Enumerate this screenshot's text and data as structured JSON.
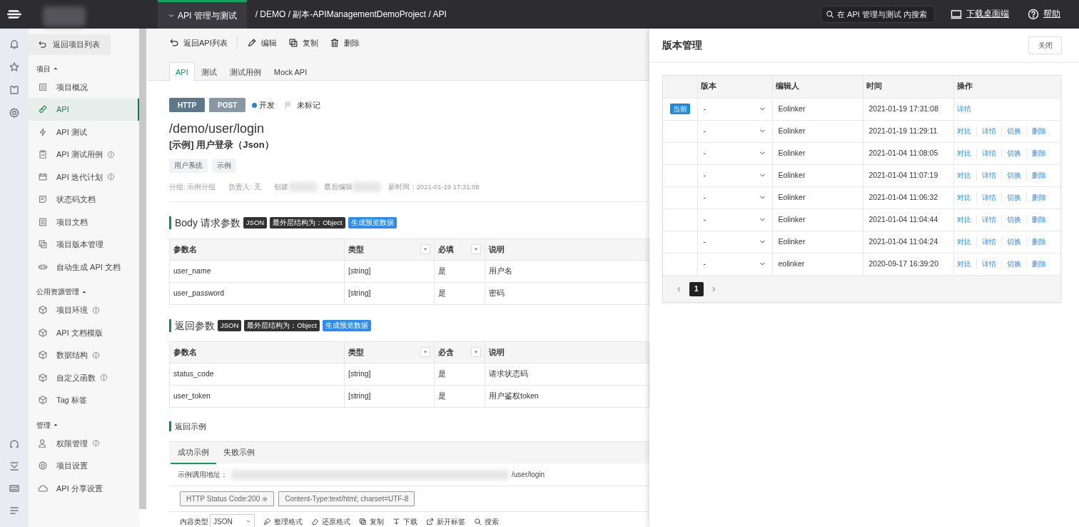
{
  "top_bar": {
    "module": "API 管理与测试",
    "breadcrumb": "/ DEMO / 副本-APIManagementDemoProject / API",
    "search": {
      "placeholder": "在 API 管理与测试 内搜索"
    },
    "links": [
      "下载桌面端",
      "帮助"
    ]
  },
  "sidebar": {
    "back": "返回项目列表",
    "sections": [
      {
        "title": "项目",
        "expanded": true,
        "items": [
          {
            "label": "项目概况",
            "selected": false,
            "info": false
          },
          {
            "label": "API",
            "selected": true,
            "info": false
          },
          {
            "label": "API 测试",
            "selected": false,
            "info": false
          },
          {
            "label": "API 测试用例",
            "selected": false,
            "info": true
          },
          {
            "label": "API 迭代计划",
            "selected": false,
            "info": true
          },
          {
            "label": "状态码文档",
            "selected": false,
            "info": false
          },
          {
            "label": "项目文档",
            "selected": false,
            "info": false
          },
          {
            "label": "项目版本管理",
            "selected": false,
            "info": false
          },
          {
            "label": "自动生成 API 文档",
            "selected": false,
            "info": false
          }
        ]
      },
      {
        "title": "公用资源管理",
        "expanded": true,
        "items": [
          {
            "label": "项目环境",
            "selected": false,
            "info": true
          },
          {
            "label": "API 文档模版",
            "selected": false,
            "info": false
          },
          {
            "label": "数据结构",
            "selected": false,
            "info": true
          },
          {
            "label": "自定义函数",
            "selected": false,
            "info": true
          },
          {
            "label": "Tag 标签",
            "selected": false,
            "info": false
          }
        ]
      },
      {
        "title": "管理",
        "expanded": true,
        "items": [
          {
            "label": "权限管理",
            "selected": false,
            "info": true
          },
          {
            "label": "项目设置",
            "selected": false,
            "info": false
          },
          {
            "label": "API 分享设置",
            "selected": false,
            "info": false
          }
        ]
      }
    ]
  },
  "toolbar": [
    "返回API列表",
    "编辑",
    "复制",
    "删除"
  ],
  "tabs": [
    {
      "label": "API",
      "selected": true
    },
    {
      "label": "测试",
      "selected": false
    },
    {
      "label": "测试用例",
      "selected": false
    },
    {
      "label": "Mock API",
      "selected": false
    }
  ],
  "api": {
    "protocol": "HTTP",
    "method": "POST",
    "status": {
      "label": "开发",
      "color": "#1e88e5"
    },
    "mark": "未标记",
    "path": "/demo/user/login",
    "title": "[示例] 用户登录（Json）",
    "tags": [
      "用户系统",
      "示例"
    ],
    "meta": [
      {
        "text": "分组: 示例分组",
        "redacted": false
      },
      {
        "text": "负责人: 无",
        "redacted": false
      },
      {
        "text": "创建",
        "redacted": true
      },
      {
        "text": "最后编辑",
        "redacted": true
      },
      {
        "text": "新时间：2021-01-19 17:31:08",
        "redacted": false
      }
    ]
  },
  "sections": [
    {
      "title": "Body 请求参数",
      "badges": [
        {
          "text": "JSON",
          "kind": "dark"
        },
        {
          "text": "最外层结构为：Object",
          "kind": "dark"
        },
        {
          "text": "生成预览数据",
          "kind": "action"
        }
      ],
      "columns": [
        {
          "label": "参数名",
          "filter": false
        },
        {
          "label": "类型",
          "filter": true
        },
        {
          "label": "必填",
          "filter": true
        },
        {
          "label": "说明",
          "filter": false
        }
      ],
      "rows": [
        [
          "user_name",
          "[string]",
          "是",
          "用户名"
        ],
        [
          "user_password",
          "[string]",
          "是",
          "密码"
        ]
      ]
    },
    {
      "title": "返回参数",
      "badges": [
        {
          "text": "JSON",
          "kind": "dark"
        },
        {
          "text": "最外层结构为：Object",
          "kind": "dark"
        },
        {
          "text": "生成预览数据",
          "kind": "action"
        }
      ],
      "columns": [
        {
          "label": "参数名",
          "filter": false
        },
        {
          "label": "类型",
          "filter": true
        },
        {
          "label": "必含",
          "filter": true
        },
        {
          "label": "说明",
          "filter": false
        }
      ],
      "rows": [
        [
          "status_code",
          "[string]",
          "是",
          "请求状态码"
        ],
        [
          "user_token",
          "[string]",
          "是",
          "用户鉴权token"
        ]
      ]
    }
  ],
  "example": {
    "title": "返回示例",
    "tabs": [
      {
        "label": "成功示例",
        "selected": true
      },
      {
        "label": "失败示例",
        "selected": false
      }
    ],
    "address_label": "示例调用地址：",
    "address": "/user/login",
    "address_redacted": true,
    "chips": [
      "HTTP Status Code:200",
      "Content-Type:text/html; charset=UTF-8"
    ],
    "format_label": "内容类型",
    "format": "JSON",
    "actions": [
      "整理格式",
      "还原格式",
      "复制",
      "下载",
      "新开标签",
      "搜索"
    ]
  },
  "version_panel": {
    "title": "版本管理",
    "close": "关闭",
    "columns": [
      "版本",
      "编辑人",
      "时间",
      "操作"
    ],
    "rows": [
      {
        "current": true,
        "badge": "当前",
        "version": "-",
        "editor": "Eolinker",
        "time": "2021-01-19 17:31:08",
        "actions": [
          "详情"
        ]
      },
      {
        "current": false,
        "version": "-",
        "editor": "Eolinker",
        "time": "2021-01-19 11:29:11",
        "actions": [
          "对比",
          "详情",
          "切换",
          "删除"
        ]
      },
      {
        "current": false,
        "version": "-",
        "editor": "Eolinker",
        "time": "2021-01-04 11:08:05",
        "actions": [
          "对比",
          "详情",
          "切换",
          "删除"
        ]
      },
      {
        "current": false,
        "version": "-",
        "editor": "Eolinker",
        "time": "2021-01-04 11:07:19",
        "actions": [
          "对比",
          "详情",
          "切换",
          "删除"
        ]
      },
      {
        "current": false,
        "version": "-",
        "editor": "Eolinker",
        "time": "2021-01-04 11:06:32",
        "actions": [
          "对比",
          "详情",
          "切换",
          "删除"
        ]
      },
      {
        "current": false,
        "version": "-",
        "editor": "Eolinker",
        "time": "2021-01-04 11:04:44",
        "actions": [
          "对比",
          "详情",
          "切换",
          "删除"
        ]
      },
      {
        "current": false,
        "version": "-",
        "editor": "Eolinker",
        "time": "2021-01-04 11:04:24",
        "actions": [
          "对比",
          "详情",
          "切换",
          "删除"
        ]
      },
      {
        "current": false,
        "version": "-",
        "editor": "eolinker",
        "time": "2020-09-17 16:39:20",
        "actions": [
          "对比",
          "详情",
          "切换",
          "删除"
        ]
      }
    ],
    "pagination": {
      "prev": "‹",
      "next": "›",
      "pages": [
        {
          "label": "1",
          "selected": true
        }
      ]
    }
  }
}
